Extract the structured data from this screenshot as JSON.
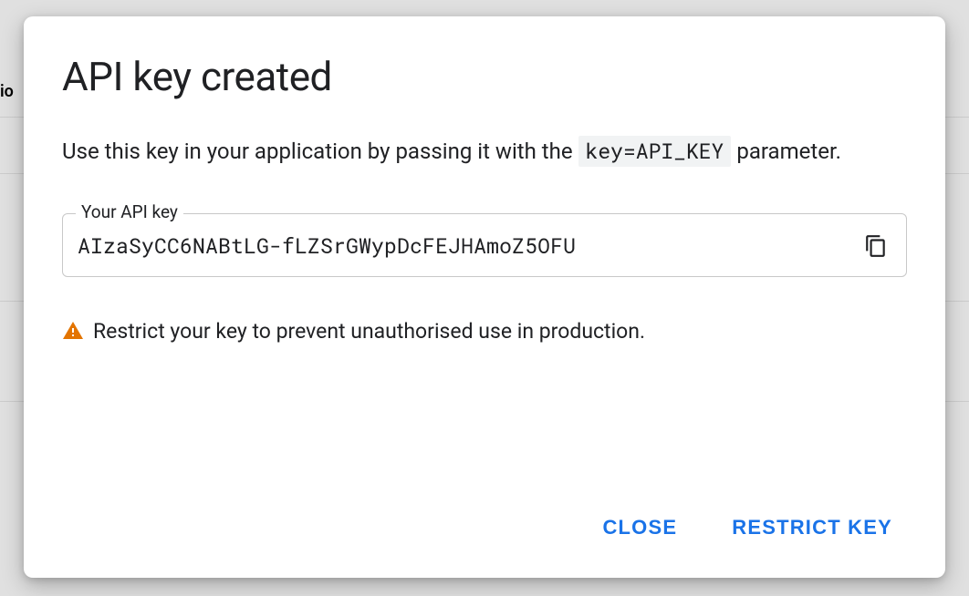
{
  "dialog": {
    "title": "API key created",
    "description_pre": "Use this key in your application by passing it with the ",
    "description_code": "key=API_KEY",
    "description_post": " parameter.",
    "field_label": "Your API key",
    "api_key_value": "AIzaSyCC6NABtLG-fLZSrGWypDcFEJHAmoZ5OFU",
    "warning_text": "Restrict your key to prevent unauthorised use in production.",
    "actions": {
      "close": "CLOSE",
      "restrict": "RESTRICT KEY"
    }
  },
  "backdrop": {
    "partial_text": "io"
  }
}
